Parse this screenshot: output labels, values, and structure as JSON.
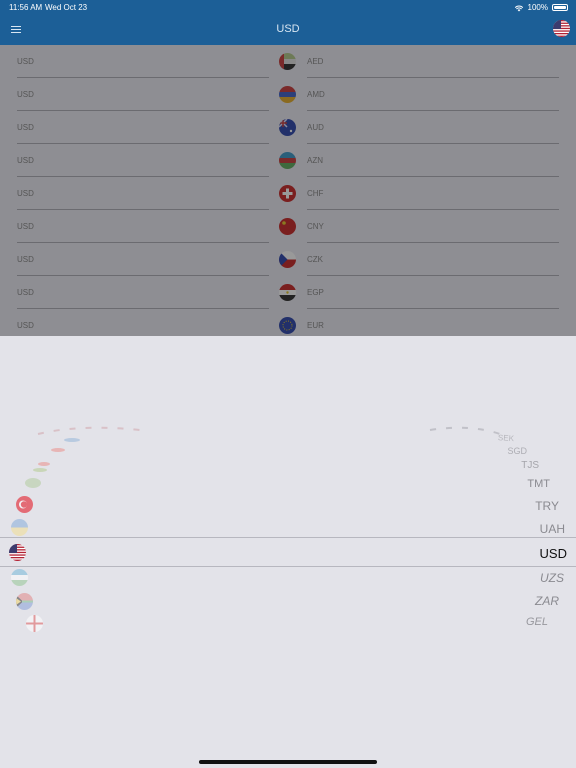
{
  "status_bar": {
    "time": "11:56 AM",
    "date": "Wed Oct 23",
    "battery": "100%"
  },
  "nav": {
    "title": "USD",
    "menu_icon": "hamburger-menu-icon",
    "flag_icon": "us-flag-icon"
  },
  "list": {
    "rows": [
      {
        "base": "USD",
        "code": "AED",
        "flag": "uae-flag-icon"
      },
      {
        "base": "USD",
        "code": "AMD",
        "flag": "armenia-flag-icon"
      },
      {
        "base": "USD",
        "code": "AUD",
        "flag": "australia-flag-icon"
      },
      {
        "base": "USD",
        "code": "AZN",
        "flag": "azerbaijan-flag-icon"
      },
      {
        "base": "USD",
        "code": "CHF",
        "flag": "switzerland-flag-icon"
      },
      {
        "base": "USD",
        "code": "CNY",
        "flag": "china-flag-icon"
      },
      {
        "base": "USD",
        "code": "CZK",
        "flag": "czech-flag-icon"
      },
      {
        "base": "USD",
        "code": "EGP",
        "flag": "egypt-flag-icon"
      },
      {
        "base": "USD",
        "code": "EUR",
        "flag": "eu-flag-icon"
      }
    ]
  },
  "picker": {
    "codes": [
      "SEK",
      "SGD",
      "TJS",
      "TMT",
      "TRY",
      "UAH",
      "USD",
      "UZS",
      "ZAR",
      "GEL"
    ],
    "selected": "USD",
    "flags": [
      "turkey-flag-icon",
      "ukraine-flag-icon",
      "us-flag-icon",
      "uzbekistan-flag-icon",
      "south-africa-flag-icon",
      "georgia-flag-icon"
    ],
    "colors": {
      "nav_bar": "#1c5f97",
      "picker_bg": "#e3e3e9",
      "dim_overlay": "#8e8e93"
    }
  }
}
